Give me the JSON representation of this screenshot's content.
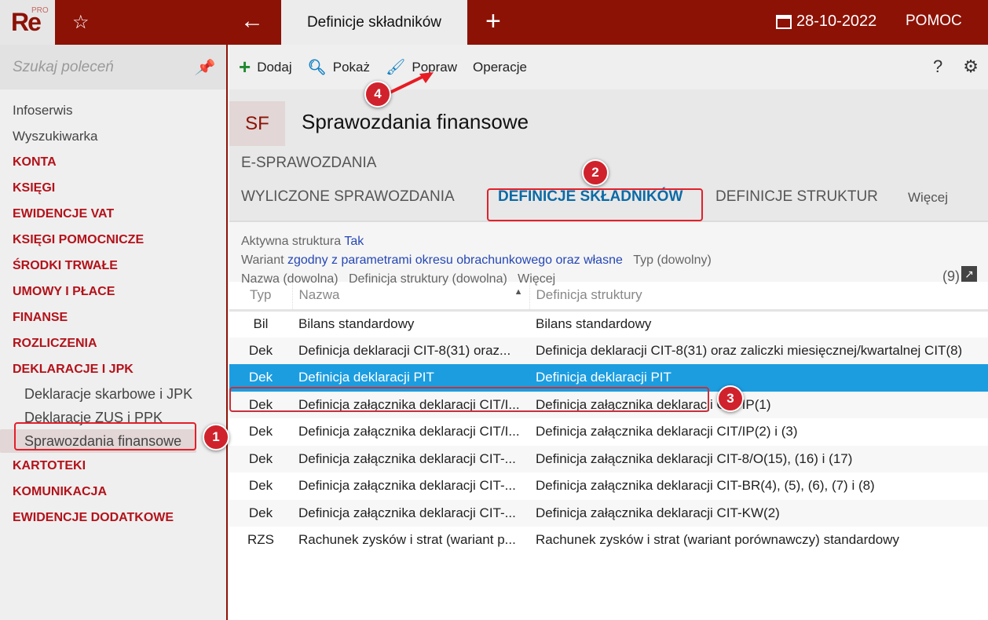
{
  "header": {
    "logo": "Re",
    "logo_sup": "PRO",
    "tab_title": "Definicje składników",
    "date": "28-10-2022",
    "help": "POMOC"
  },
  "sidebar": {
    "search_placeholder": "Szukaj poleceń",
    "items": [
      {
        "label": "Infoserwis",
        "kind": "plain"
      },
      {
        "label": "Wyszukiwarka",
        "kind": "plain"
      },
      {
        "label": "KONTA",
        "kind": "sec"
      },
      {
        "label": "KSIĘGI",
        "kind": "sec"
      },
      {
        "label": "EWIDENCJE VAT",
        "kind": "sec"
      },
      {
        "label": "KSIĘGI POMOCNICZE",
        "kind": "sec"
      },
      {
        "label": "ŚRODKI TRWAŁE",
        "kind": "sec"
      },
      {
        "label": "UMOWY I PŁACE",
        "kind": "sec"
      },
      {
        "label": "FINANSE",
        "kind": "sec"
      },
      {
        "label": "ROZLICZENIA",
        "kind": "sec"
      },
      {
        "label": "DEKLARACJE I JPK",
        "kind": "sec"
      },
      {
        "label": "Deklaracje skarbowe i JPK",
        "kind": "sub"
      },
      {
        "label": "Deklaracje ZUS i PPK",
        "kind": "sub"
      },
      {
        "label": "Sprawozdania finansowe",
        "kind": "sub active"
      },
      {
        "label": "KARTOTEKI",
        "kind": "sec"
      },
      {
        "label": "KOMUNIKACJA",
        "kind": "sec"
      },
      {
        "label": "EWIDENCJE DODATKOWE",
        "kind": "sec"
      }
    ]
  },
  "toolbar": {
    "add": "Dodaj",
    "show": "Pokaż",
    "edit": "Popraw",
    "ops": "Operacje",
    "help": "?"
  },
  "page": {
    "badge": "SF",
    "title": "Sprawozdania finansowe"
  },
  "tabs": {
    "group": "E-SPRAWOZDANIA",
    "items": [
      "WYLICZONE SPRAWOZDANIA",
      "DEFINICJE SKŁADNIKÓW",
      "DEFINICJE STRUKTUR",
      "Więcej"
    ],
    "active": 1
  },
  "filters": {
    "l1": "Aktywna struktura",
    "v1": "Tak",
    "l2": "Wariant",
    "v2": "zgodny z parametrami okresu obrachunkowego oraz własne",
    "l3": "Typ (dowolny)",
    "l4": "Nazwa (dowolna)",
    "l5": "Definicja struktury (dowolna)",
    "l6": "Więcej",
    "count": "(9)"
  },
  "table": {
    "columns": [
      "Typ",
      "Nazwa",
      "Definicja struktury"
    ],
    "sort_icon": "▲",
    "rows": [
      [
        "Bil",
        "Bilans standardowy",
        "Bilans standardowy"
      ],
      [
        "Dek",
        "Definicja deklaracji CIT-8(31) oraz...",
        "Definicja deklaracji CIT-8(31) oraz zaliczki miesięcznej/kwartalnej CIT(8)"
      ],
      [
        "Dek",
        "Definicja deklaracji PIT",
        "Definicja deklaracji PIT"
      ],
      [
        "Dek",
        "Definicja załącznika deklaracji CIT/I...",
        "Definicja załącznika deklaracji CIT/IP(1)"
      ],
      [
        "Dek",
        "Definicja załącznika deklaracji CIT/I...",
        "Definicja załącznika deklaracji CIT/IP(2) i (3)"
      ],
      [
        "Dek",
        "Definicja załącznika deklaracji CIT-...",
        "Definicja załącznika deklaracji CIT-8/O(15), (16) i (17)"
      ],
      [
        "Dek",
        "Definicja załącznika deklaracji CIT-...",
        "Definicja załącznika deklaracji CIT-BR(4), (5), (6), (7) i (8)"
      ],
      [
        "Dek",
        "Definicja załącznika deklaracji CIT-...",
        "Definicja załącznika deklaracji CIT-KW(2)"
      ],
      [
        "RZS",
        "Rachunek zysków i strat (wariant p...",
        "Rachunek zysków i strat (wariant porównawczy) standardowy"
      ]
    ],
    "selected": 2
  },
  "annotations": [
    "1",
    "2",
    "3",
    "4"
  ],
  "colors": {
    "brand": "#8c1206",
    "selected": "#1c9de0",
    "annotation": "#d0222c"
  }
}
